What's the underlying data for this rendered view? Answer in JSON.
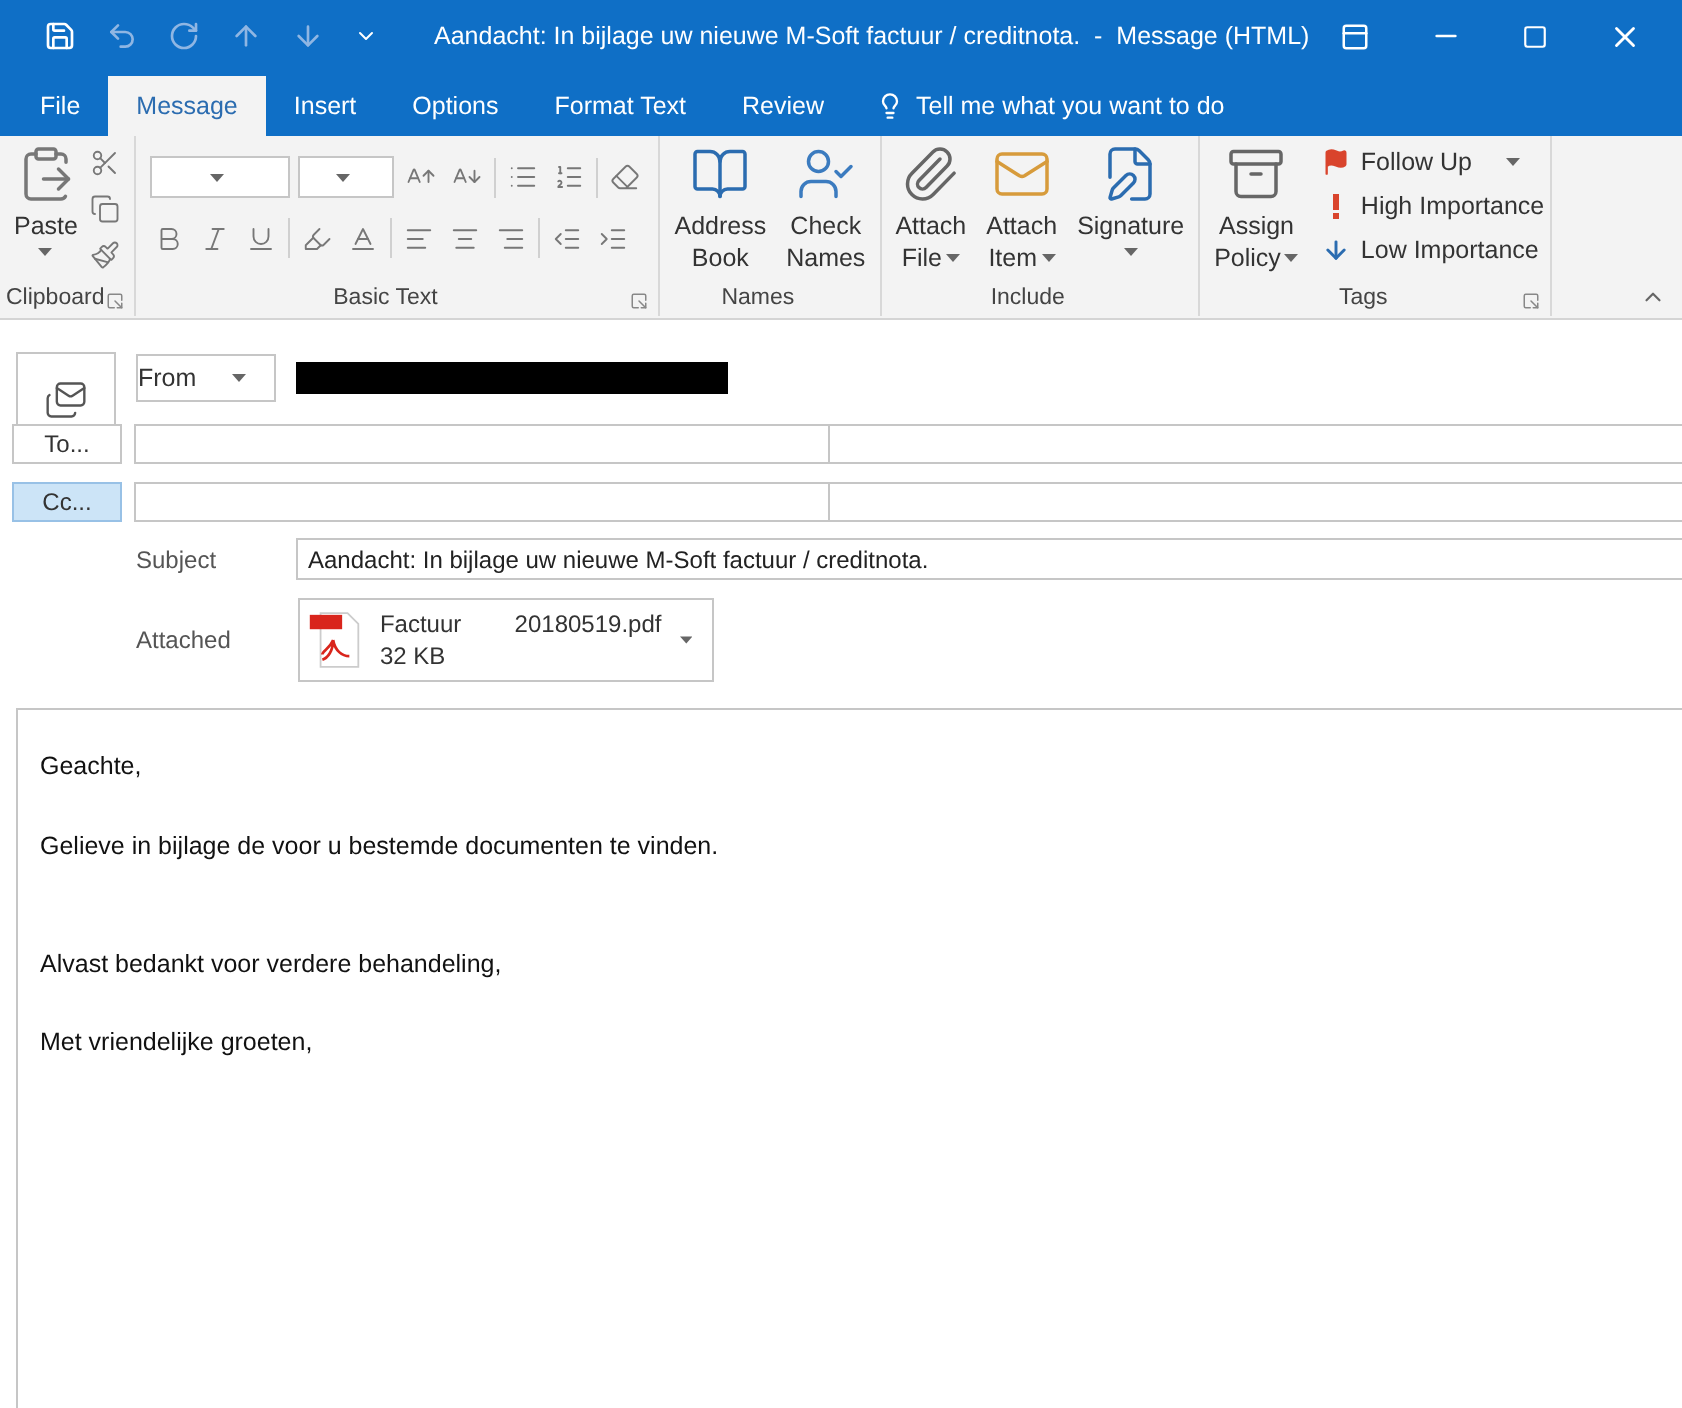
{
  "window": {
    "title": "Aandacht: In bijlage uw nieuwe M-Soft factuur / creditnota.  -  Message (HTML)"
  },
  "tabs": [
    {
      "label": "File",
      "selected": false
    },
    {
      "label": "Message",
      "selected": true
    },
    {
      "label": "Insert",
      "selected": false
    },
    {
      "label": "Options",
      "selected": false
    },
    {
      "label": "Format Text",
      "selected": false
    },
    {
      "label": "Review",
      "selected": false
    }
  ],
  "tell_me": {
    "placeholder": "Tell me what you want to do"
  },
  "ribbon": {
    "groups": [
      {
        "kind": "clipboard",
        "label": "Clipboard",
        "launcher": true,
        "buttons": [
          {
            "lines": [
              "Paste"
            ],
            "dropdown": true
          }
        ]
      },
      {
        "kind": "basic_text",
        "label": "Basic Text",
        "launcher": true
      },
      {
        "kind": "large",
        "label": "Names",
        "buttons": [
          {
            "lines": [
              "Address",
              "Book"
            ],
            "dropdown": false
          },
          {
            "lines": [
              "Check",
              "Names"
            ],
            "dropdown": false
          }
        ]
      },
      {
        "kind": "large",
        "label": "Include",
        "buttons": [
          {
            "lines": [
              "Attach",
              "File"
            ],
            "dropdown": true
          },
          {
            "lines": [
              "Attach",
              "Item"
            ],
            "dropdown": true
          },
          {
            "lines": [
              "Signature"
            ],
            "dropdown": true
          }
        ]
      },
      {
        "kind": "tags",
        "label": "Tags",
        "launcher": true,
        "buttons": [
          {
            "lines": [
              "Assign",
              "Policy"
            ],
            "dropdown": true
          }
        ],
        "small": [
          {
            "label": "Follow Up",
            "dropdown": true
          },
          {
            "label": "High Importance",
            "dropdown": false
          },
          {
            "label": "Low Importance",
            "dropdown": false
          }
        ]
      }
    ]
  },
  "compose": {
    "from": {
      "label": "From"
    },
    "recipients": [
      {
        "label": "To...",
        "selected": false
      },
      {
        "label": "Cc...",
        "selected": true
      }
    ],
    "subject": {
      "label": "Subject",
      "value": "Aandacht: In bijlage uw nieuwe M-Soft factuur / creditnota."
    },
    "attached": {
      "label": "Attached",
      "file": {
        "name": "Factuur        20180519.pdf",
        "size": "32 KB"
      }
    }
  },
  "body": {
    "blocks": [
      [
        "Geachte,",
        "Gelieve in bijlage de voor u bestemde documenten te vinden."
      ],
      [
        "Alvast bedankt voor verdere behandeling,",
        "Met vriendelijke groeten,"
      ]
    ]
  }
}
